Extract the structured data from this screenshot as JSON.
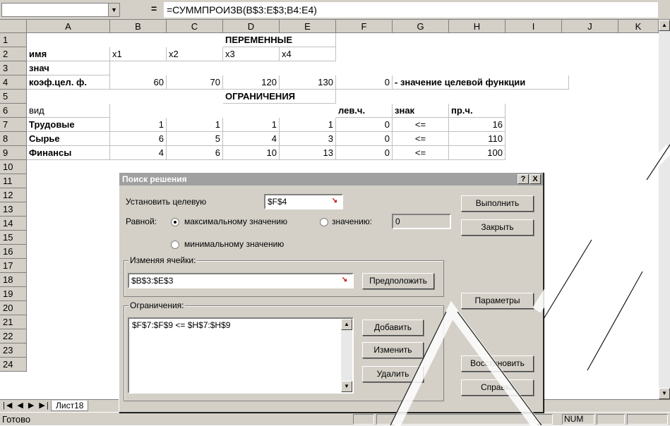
{
  "formula_bar": {
    "eq": "=",
    "formula": "=СУММПРОИЗВ(B$3:E$3;B4:E4)"
  },
  "columns": [
    "A",
    "B",
    "C",
    "D",
    "E",
    "F",
    "G",
    "H",
    "I",
    "J",
    "K"
  ],
  "rows": [
    "1",
    "2",
    "3",
    "4",
    "5",
    "6",
    "7",
    "8",
    "9",
    "10",
    "11",
    "12",
    "13",
    "14",
    "15",
    "16",
    "17",
    "18",
    "19",
    "20",
    "21",
    "22",
    "23",
    "24"
  ],
  "cells": {
    "d1": "ПЕРЕМЕННЫЕ",
    "a2": "имя",
    "b2": "x1",
    "c2": "x2",
    "d2": "x3",
    "e2": "x4",
    "a3": "знач",
    "a4": "коэф.цел. ф.",
    "b4": "60",
    "c4": "70",
    "d4": "120",
    "e4": "130",
    "f4": "0",
    "g4": "- значение целевой функции",
    "d5": "ОГРАНИЧЕНИЯ",
    "a6": "вид",
    "f6": "лев.ч.",
    "g6": "знак",
    "h6": "пр.ч.",
    "a7": "Трудовые",
    "b7": "1",
    "c7": "1",
    "d7": "1",
    "e7": "1",
    "f7": "0",
    "g7": "<=",
    "h7": "16",
    "a8": "Сырье",
    "b8": "6",
    "c8": "5",
    "d8": "4",
    "e8": "3",
    "f8": "0",
    "g8": "<=",
    "h8": "110",
    "a9": "Финансы",
    "b9": "4",
    "c9": "6",
    "d9": "10",
    "e9": "13",
    "f9": "0",
    "g9": "<=",
    "h9": "100"
  },
  "sheet_tab": "Лист18",
  "status": {
    "ready": "Готово",
    "num": "NUM"
  },
  "dialog": {
    "title": "Поиск решения",
    "help_btn": "?",
    "close_btn": "X",
    "target_label": "Установить целевую",
    "target_value": "$F$4",
    "equal_label": "Равной:",
    "radio_max": "максимальному значению",
    "radio_value": "значению:",
    "value_field": "0",
    "radio_min": "минимальному значению",
    "changing_label": "Изменяя ячейки:",
    "changing_value": "$B$3:$E$3",
    "guess_btn": "Предположить",
    "constraints_label": "Ограничения:",
    "constraints": [
      "$F$7:$F$9 <= $H$7:$H$9"
    ],
    "add_btn": "Добавить",
    "change_btn": "Изменить",
    "delete_btn": "Удалить",
    "run_btn": "Выполнить",
    "close_button": "Закрыть",
    "params_btn": "Параметры",
    "restore_btn": "Восстановить",
    "help_button": "Справка"
  }
}
